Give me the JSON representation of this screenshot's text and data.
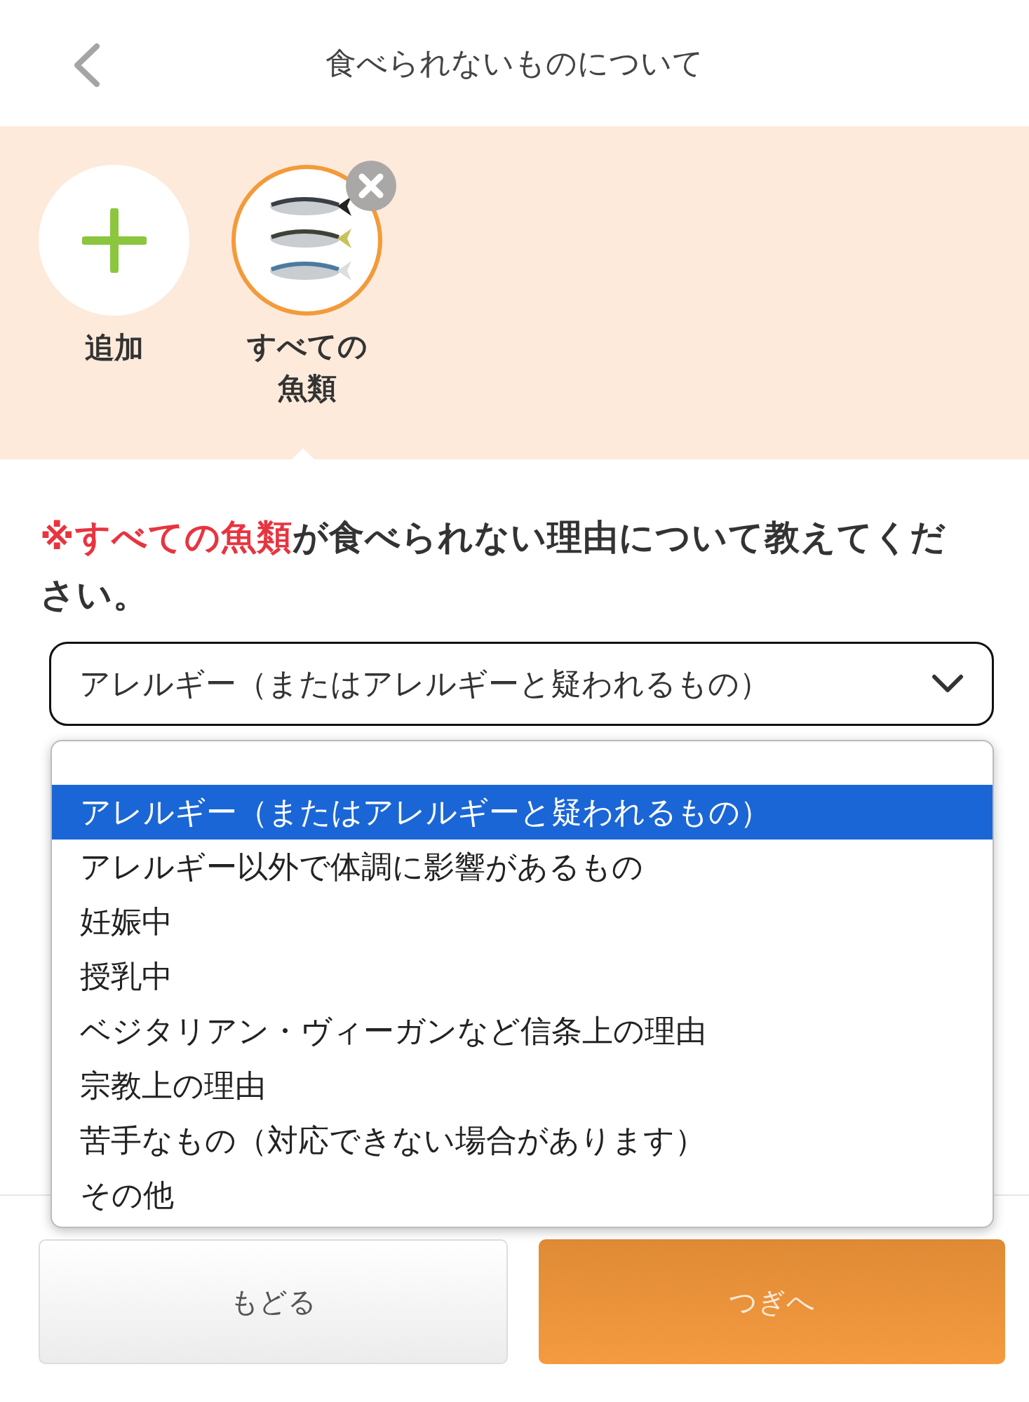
{
  "header": {
    "title": "食べられないものについて"
  },
  "items": [
    {
      "kind": "add",
      "label": "追加"
    },
    {
      "kind": "food",
      "label_lines": [
        "すべての",
        "魚類"
      ],
      "selected": true
    }
  ],
  "question": {
    "highlight": "※すべての魚類",
    "text": "が食べられない理由について教えてください。"
  },
  "select": {
    "value": "アレルギー（またはアレルギーと疑われるもの）",
    "expanded": true,
    "options": [
      {
        "label": "アレルギー（またはアレルギーと疑われるもの）",
        "selected": true
      },
      {
        "label": "アレルギー以外で体調に影響があるもの",
        "selected": false
      },
      {
        "label": "妊娠中",
        "selected": false
      },
      {
        "label": "授乳中",
        "selected": false
      },
      {
        "label": "ベジタリアン・ヴィーガンなど信条上の理由",
        "selected": false
      },
      {
        "label": "宗教上の理由",
        "selected": false
      },
      {
        "label": "苦手なもの（対応できない場合があります）",
        "selected": false
      },
      {
        "label": "その他",
        "selected": false
      }
    ]
  },
  "buttons": [
    {
      "kind": "back",
      "label": "もどる"
    },
    {
      "kind": "next",
      "label": "つぎへ"
    }
  ]
}
